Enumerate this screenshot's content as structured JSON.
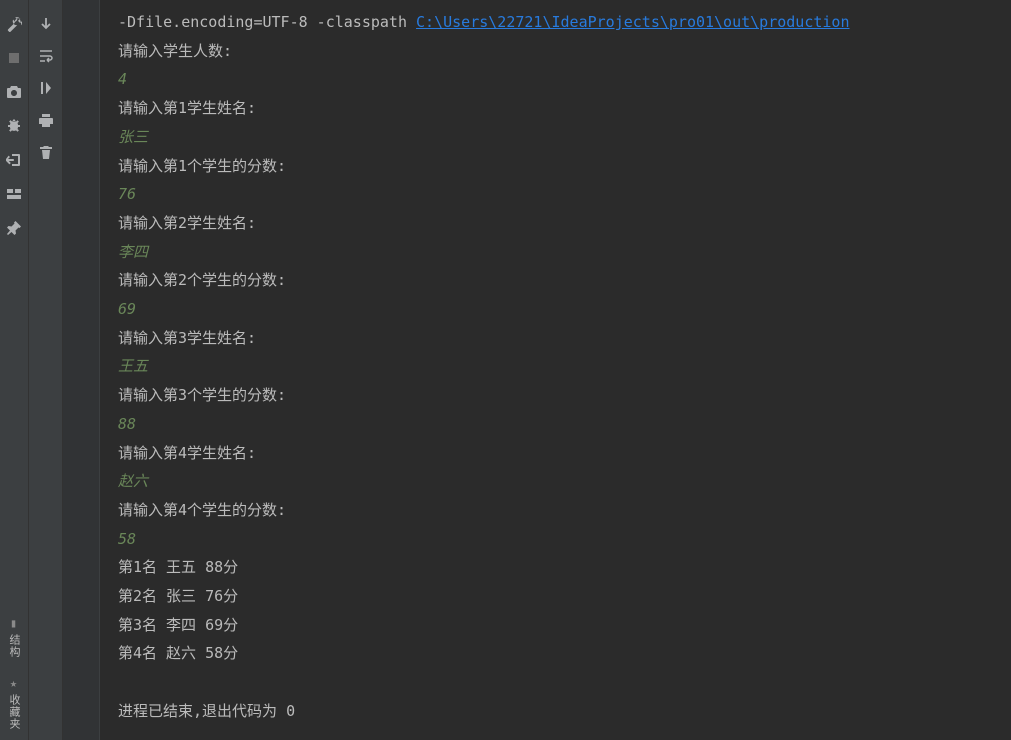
{
  "leftToolbar": {
    "structure_label": "结构",
    "favorites_label": "收藏夹"
  },
  "argLine": {
    "prefix": "  -Dfile.encoding=UTF-8 -classpath ",
    "link": "C:\\Users\\22721\\IdeaProjects\\pro01\\out\\production"
  },
  "lines": [
    {
      "type": "prompt",
      "text": "请输入学生人数:"
    },
    {
      "type": "input",
      "text": "4"
    },
    {
      "type": "prompt",
      "text": "请输入第1学生姓名:"
    },
    {
      "type": "input",
      "text": "张三"
    },
    {
      "type": "prompt",
      "text": "请输入第1个学生的分数:"
    },
    {
      "type": "input",
      "text": "76"
    },
    {
      "type": "prompt",
      "text": "请输入第2学生姓名:"
    },
    {
      "type": "input",
      "text": "李四"
    },
    {
      "type": "prompt",
      "text": "请输入第2个学生的分数:"
    },
    {
      "type": "input",
      "text": "69"
    },
    {
      "type": "prompt",
      "text": "请输入第3学生姓名:"
    },
    {
      "type": "input",
      "text": "王五"
    },
    {
      "type": "prompt",
      "text": "请输入第3个学生的分数:"
    },
    {
      "type": "input",
      "text": "88"
    },
    {
      "type": "prompt",
      "text": "请输入第4学生姓名:"
    },
    {
      "type": "input",
      "text": "赵六"
    },
    {
      "type": "prompt",
      "text": "请输入第4个学生的分数:"
    },
    {
      "type": "input",
      "text": "58"
    },
    {
      "type": "output",
      "text": "第1名    王五 88分"
    },
    {
      "type": "output",
      "text": "第2名    张三 76分"
    },
    {
      "type": "output",
      "text": "第3名    李四 69分"
    },
    {
      "type": "output",
      "text": "第4名    赵六 58分"
    },
    {
      "type": "blank",
      "text": ""
    },
    {
      "type": "output",
      "text": "进程已结束,退出代码为 0"
    }
  ]
}
